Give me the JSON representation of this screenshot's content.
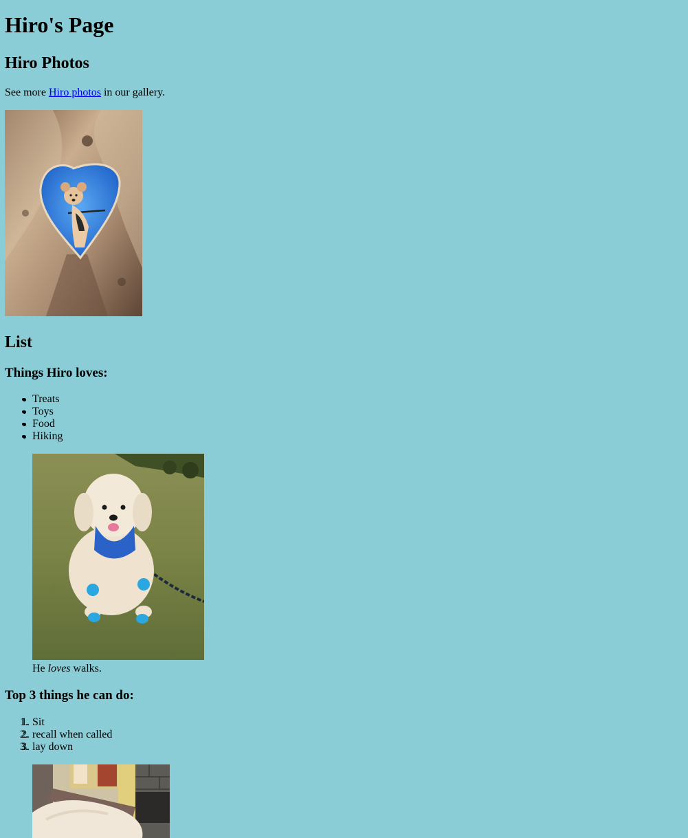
{
  "page": {
    "title": "Hiro's Page",
    "photos_heading": "Hiro Photos",
    "intro_before": "See more ",
    "intro_link": "Hiro photos",
    "intro_after": " in our gallery."
  },
  "list_section": {
    "heading": "List",
    "loves_heading": "Things Hiro loves:",
    "loves": [
      "Treats",
      "Toys",
      "Food",
      "Hiking"
    ],
    "caption_before": "He ",
    "caption_emphasis": "loves",
    "caption_after": " walks.",
    "skills_heading": "Top 3 things he can do:",
    "skills": [
      "Sit",
      "recall when called",
      "lay down"
    ],
    "skill_markers": [
      "1.",
      "2.",
      "3."
    ]
  },
  "colors": {
    "background": "#8acdd6",
    "link": "#0000ee"
  }
}
